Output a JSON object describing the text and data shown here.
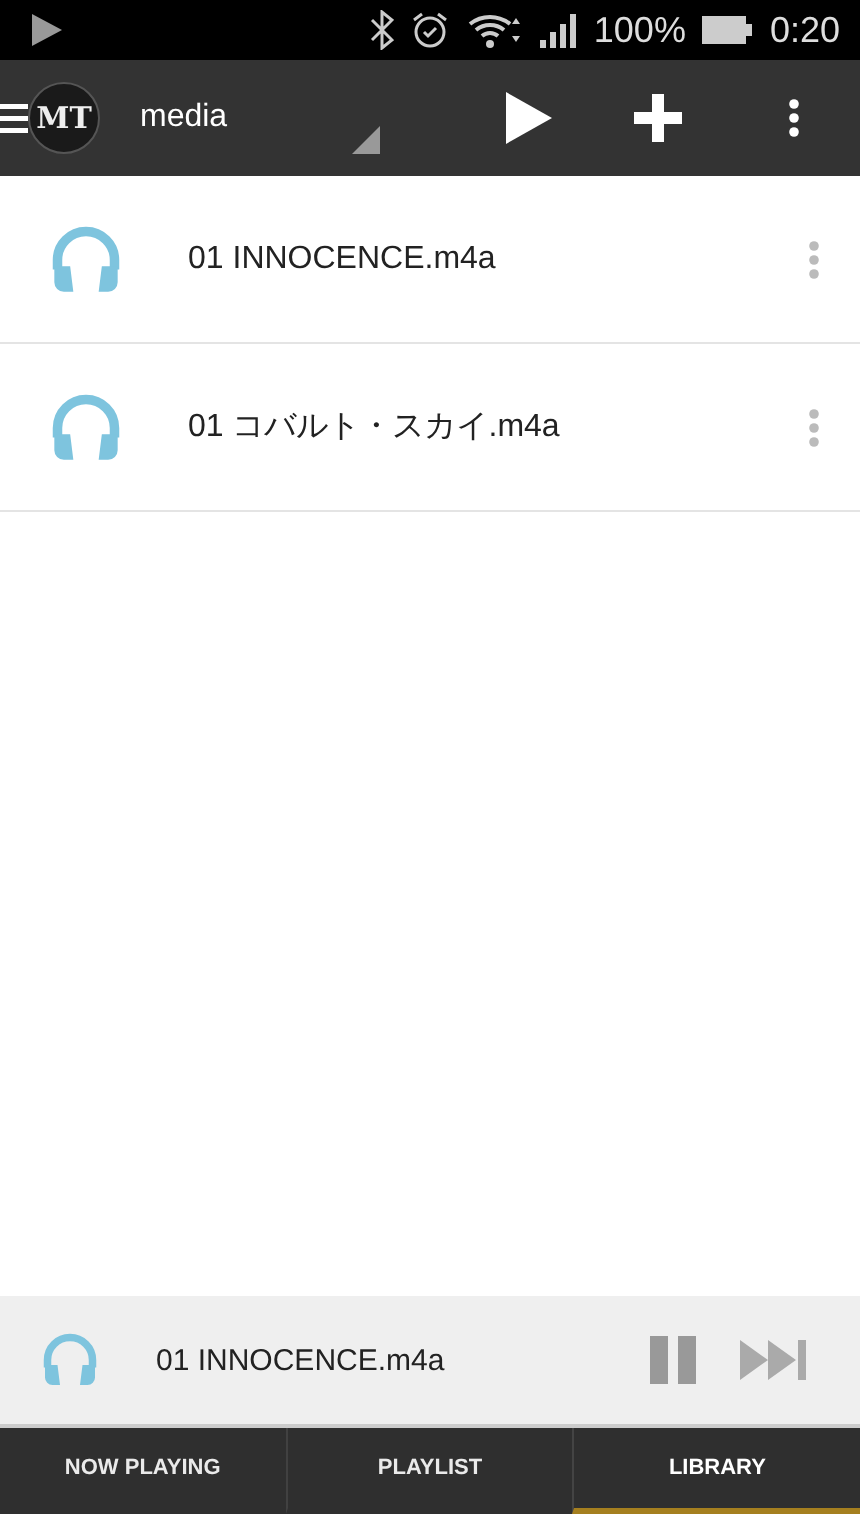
{
  "status_bar": {
    "battery": "100%",
    "time": "0:20"
  },
  "toolbar": {
    "logo": "MT",
    "title": "media"
  },
  "tracks": [
    {
      "name": "01 INNOCENCE.m4a"
    },
    {
      "name": "01 コバルト・スカイ.m4a"
    }
  ],
  "mini_player": {
    "track": "01 INNOCENCE.m4a",
    "playing": true
  },
  "tabs": [
    {
      "label": "NOW PLAYING",
      "selected": false
    },
    {
      "label": "PLAYLIST",
      "selected": false
    },
    {
      "label": "LIBRARY",
      "selected": true
    }
  ]
}
